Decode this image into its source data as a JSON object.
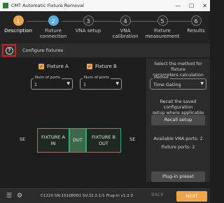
{
  "window": {
    "title": "CMT Automatic Fixture Removal",
    "controls": [
      "—",
      "☐",
      "✕"
    ]
  },
  "steps": [
    {
      "number": "1",
      "label": "Description"
    },
    {
      "number": "2",
      "label": "Fixture\nconnection"
    },
    {
      "number": "3",
      "label": "VNA setup"
    },
    {
      "number": "4",
      "label": "VNA\ncalibration"
    },
    {
      "number": "5",
      "label": "Fixture\nmeasurement"
    },
    {
      "number": "6",
      "label": "Results"
    }
  ],
  "toolbar": {
    "help_glyph": "?",
    "title": "Configure fixtures"
  },
  "fixtures": {
    "fixture_a": {
      "checked": true,
      "check_glyph": "✓",
      "label": "Fixture A",
      "ports_legend": "Num of ports",
      "ports_value": "1"
    },
    "fixture_b": {
      "checked": true,
      "check_glyph": "✓",
      "label": "Fixture B",
      "ports_legend": "Num of ports",
      "ports_value": "1"
    }
  },
  "diagram": {
    "se_left": "SE",
    "fixture_a": "FIXTURE A\nIN",
    "dut": "DUT",
    "fixture_b": "FIXTURE B\nOUT",
    "se_right": "SE",
    "colors": {
      "border": "#3aa866",
      "dut_fill": "#3a6a4b"
    }
  },
  "right_panel": {
    "method_prompt": "Select the method for fixture\nparameters calculation",
    "method_legend": "Method",
    "method_value": "Time Gating",
    "recall_text": "Recall the saved configuration\nsetup where applicable",
    "recall_button": "Recall setup",
    "vna_ports": "Available VNA ports: 2",
    "fixture_ports": "Fixture ports: 2",
    "plugin_button": "Plug-in preset"
  },
  "bottom_bar": {
    "status": "C1220 SN:15108001 SV:22.2.1/1 Plug-in v1.2.0",
    "back_label": "BACK",
    "next_label": "NEXT",
    "icons": [
      "list-icon",
      "gear-icon"
    ]
  },
  "colors": {
    "accent": "#f0a44b",
    "current_step": "#5aaee0",
    "help_highlight": "#e01b1b"
  }
}
